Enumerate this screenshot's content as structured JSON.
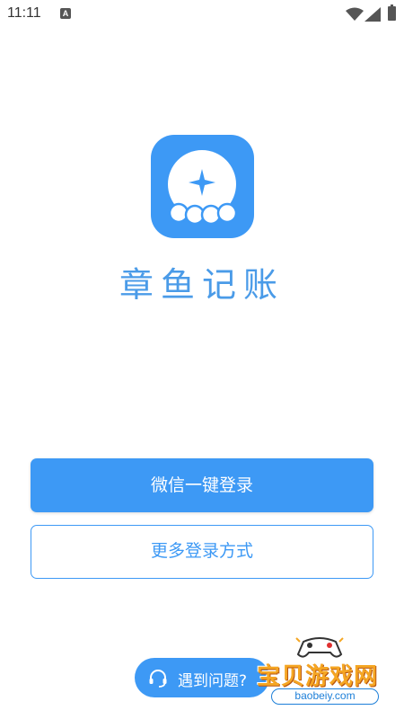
{
  "status_bar": {
    "time": "11:11",
    "notification_letter": "A"
  },
  "app": {
    "name": "章鱼记账",
    "brand_color": "#3d99f5"
  },
  "buttons": {
    "wechat_login": "微信一键登录",
    "more_login": "更多登录方式"
  },
  "help": {
    "label": "遇到问题?"
  },
  "watermark": {
    "title": "宝贝游戏网",
    "url": "baobeiy.com"
  },
  "icons": [
    "wifi-icon",
    "signal-icon",
    "battery-icon",
    "headset-icon",
    "sparkle-icon"
  ]
}
